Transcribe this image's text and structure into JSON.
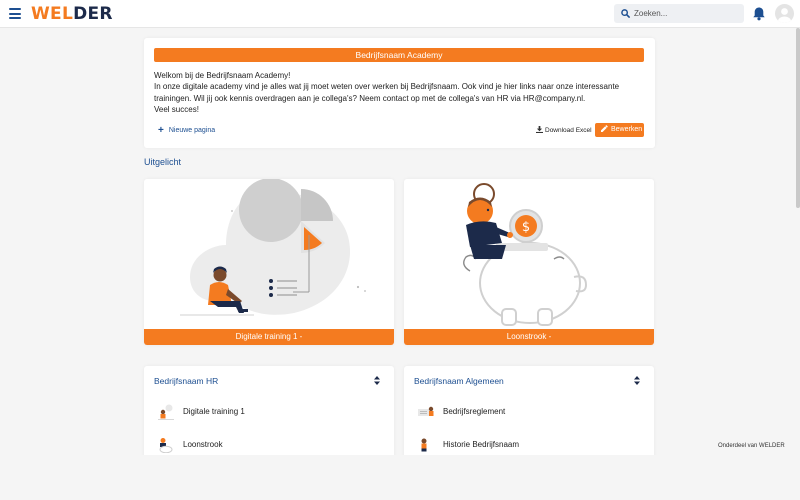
{
  "header": {
    "logo_primary": "WEL",
    "logo_secondary": "DER",
    "search_placeholder": "Zoeken...",
    "icons": [
      "hamburger-menu-icon",
      "search-icon",
      "bell-icon",
      "user-avatar-icon"
    ]
  },
  "welcome": {
    "title": "Bedrijfsnaam Academy",
    "lines": [
      "Welkom bij de Bedrijfsnaam Academy!",
      "In onze digitale academy vind je alles wat jij moet weten over werken bij Bedrijfsnaam. Ook vind je hier links naar onze interessante trainingen. Wil jij ook kennis overdragen aan je collega's? Neem contact op met de collega's van HR via HR@company.nl.",
      "Veel succes!"
    ],
    "new_page_label": "Nieuwe pagina",
    "download_label": "Download Excel",
    "edit_label": "Bewerken"
  },
  "featured": {
    "title": "Uitgelicht",
    "tiles": [
      {
        "label": "Digitale training 1 -"
      },
      {
        "label": "Loonstrook -"
      }
    ]
  },
  "lists": [
    {
      "title": "Bedrijfsnaam HR",
      "items": [
        "Digitale training 1",
        "Loonstrook"
      ]
    },
    {
      "title": "Bedrijfsnaam Algemeen",
      "items": [
        "Bedrijfsreglement",
        "Historie Bedrijfsnaam"
      ]
    }
  ],
  "footer": {
    "note": "Onderdeel van WELDER"
  },
  "colors": {
    "accent": "#f47b20",
    "brand_dark": "#1c2a4a",
    "link": "#1d4f91",
    "background": "#f5f5f5"
  }
}
